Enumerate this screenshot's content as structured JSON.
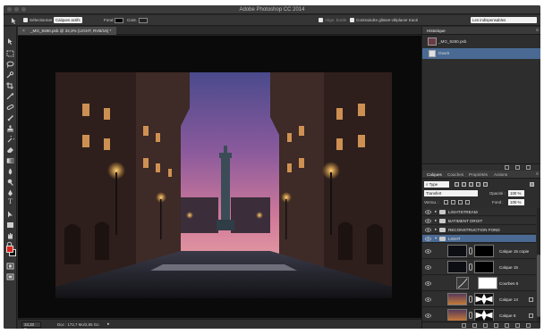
{
  "window": {
    "title": "Adobe Photoshop CC 2014"
  },
  "options_bar": {
    "select_label": "Sélectionner :",
    "select_value": "Calques actifs",
    "fill_label": "Fond",
    "stroke_label": "Cont.",
    "align_edges_label": "Align. bords",
    "constrain_label": "Contraindre glisser-déplacer tracé",
    "workspace_value": "Les indispensables"
  },
  "document": {
    "tab_label": "_MG_9260.psb @ 33,3% (LIGHT, RVB/16) *",
    "zoom": "33,33 %",
    "doc_info": "Doc : 172,7 Mo/2,95 Go"
  },
  "history": {
    "tab": "Historique",
    "snapshot": "_MG_9260.psb",
    "states": [
      "Ouvrir"
    ]
  },
  "layers_panel": {
    "tabs": [
      "Calques",
      "Couches",
      "Propriétés",
      "Actions"
    ],
    "filter_value": "Type",
    "blend_mode": "Transfert",
    "opacity_label": "Opacité :",
    "opacity_value": "100 %",
    "lock_label": "Verrou. :",
    "fill_label": "Fond :",
    "fill_value": "100 %",
    "layers": [
      {
        "name": "LIGHTSTREAM",
        "kind": "group",
        "selected": false
      },
      {
        "name": "BATIMENT DROIT",
        "kind": "group",
        "selected": false
      },
      {
        "name": "RECONSTRUCTION FOND",
        "kind": "group",
        "selected": false
      },
      {
        "name": "LIGHT",
        "kind": "group-open",
        "selected": true
      },
      {
        "name": "Calque 15 copie",
        "kind": "layer-mask",
        "selected": false
      },
      {
        "name": "Calque 15",
        "kind": "layer-mask",
        "selected": false
      },
      {
        "name": "Courbes 6",
        "kind": "adjustment",
        "selected": false
      },
      {
        "name": "Calque 14",
        "kind": "layer-mask",
        "selected": false
      },
      {
        "name": "Calque 8",
        "kind": "layer-mask",
        "selected": false
      }
    ]
  },
  "colors": {
    "foreground": "#e1251b",
    "background": "#000000",
    "selection": "#4a6a94"
  }
}
